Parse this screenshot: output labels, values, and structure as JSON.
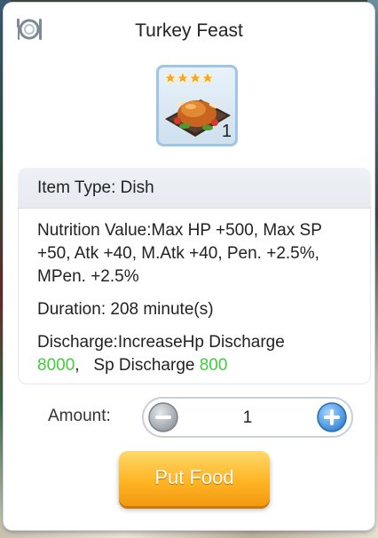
{
  "dialog": {
    "title": "Turkey Feast",
    "menu_icon": "dish-cutlery-icon"
  },
  "item": {
    "icon": "roast-turkey-icon",
    "stars": 4,
    "quantity": "1"
  },
  "info": {
    "item_type": "Item Type: Dish",
    "nutrition": "Nutrition Value:Max HP +500, Max SP +50, Atk +40, M.Atk +40, Pen. +2.5%, MPen. +2.5%",
    "duration": "Duration: 208 minute(s)",
    "discharge_prefix": "Discharge:IncreaseHp Discharge ",
    "hp_discharge_value": "8000",
    "discharge_mid": ",   Sp Discharge ",
    "sp_discharge_value": "800"
  },
  "amount": {
    "label": "Amount:",
    "value": "1",
    "minus_icon": "minus-icon",
    "plus_icon": "plus-icon"
  },
  "actions": {
    "put_food_label": "Put Food"
  },
  "colors": {
    "highlight_green": "#3fcf3a",
    "button_orange": "#ffb524",
    "frame_blue": "#9fc6e6"
  }
}
